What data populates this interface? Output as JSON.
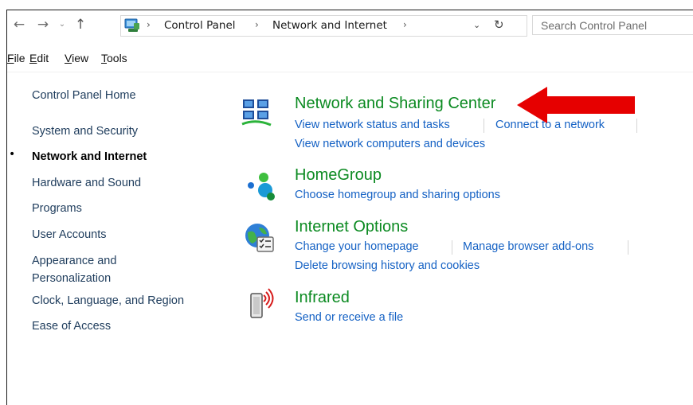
{
  "nav": {
    "back": "←",
    "forward": "→",
    "recent": "⌄",
    "up": "↑"
  },
  "address": {
    "separator": "›",
    "crumbs": [
      "Control Panel",
      "Network and Internet"
    ],
    "dropdown": "⌄",
    "refresh": "↻"
  },
  "search": {
    "placeholder": "Search Control Panel"
  },
  "menu": {
    "file": "File",
    "edit": "Edit",
    "view": "View",
    "tools": "Tools"
  },
  "sidebar": {
    "bullet": "•",
    "items": [
      {
        "label": "Control Panel Home"
      },
      {
        "label": "System and Security"
      },
      {
        "label": "Network and Internet",
        "current": true
      },
      {
        "label": "Hardware and Sound"
      },
      {
        "label": "Programs"
      },
      {
        "label": "User Accounts"
      },
      {
        "label": "Appearance and Personalization",
        "lines": [
          "Appearance and",
          "Personalization"
        ]
      },
      {
        "label": "Clock, Language, and Region"
      },
      {
        "label": "Ease of Access"
      }
    ]
  },
  "categories": [
    {
      "title": "Network and Sharing Center",
      "icon": "network-sharing-icon",
      "tasks": [
        "View network status and tasks",
        "Connect to a network",
        "View network computers and devices"
      ]
    },
    {
      "title": "HomeGroup",
      "icon": "homegroup-icon",
      "tasks": [
        "Choose homegroup and sharing options"
      ]
    },
    {
      "title": "Internet Options",
      "icon": "internet-options-icon",
      "tasks": [
        "Change your homepage",
        "Manage browser add-ons",
        "Delete browsing history and cookies"
      ]
    },
    {
      "title": "Infrared",
      "icon": "infrared-icon",
      "tasks": [
        "Send or receive a file"
      ]
    }
  ],
  "colors": {
    "category_title": "#0b8a21",
    "task_link": "#1461c4",
    "sidebar_link": "#1e3c5c",
    "annotation_arrow": "#e60000"
  }
}
